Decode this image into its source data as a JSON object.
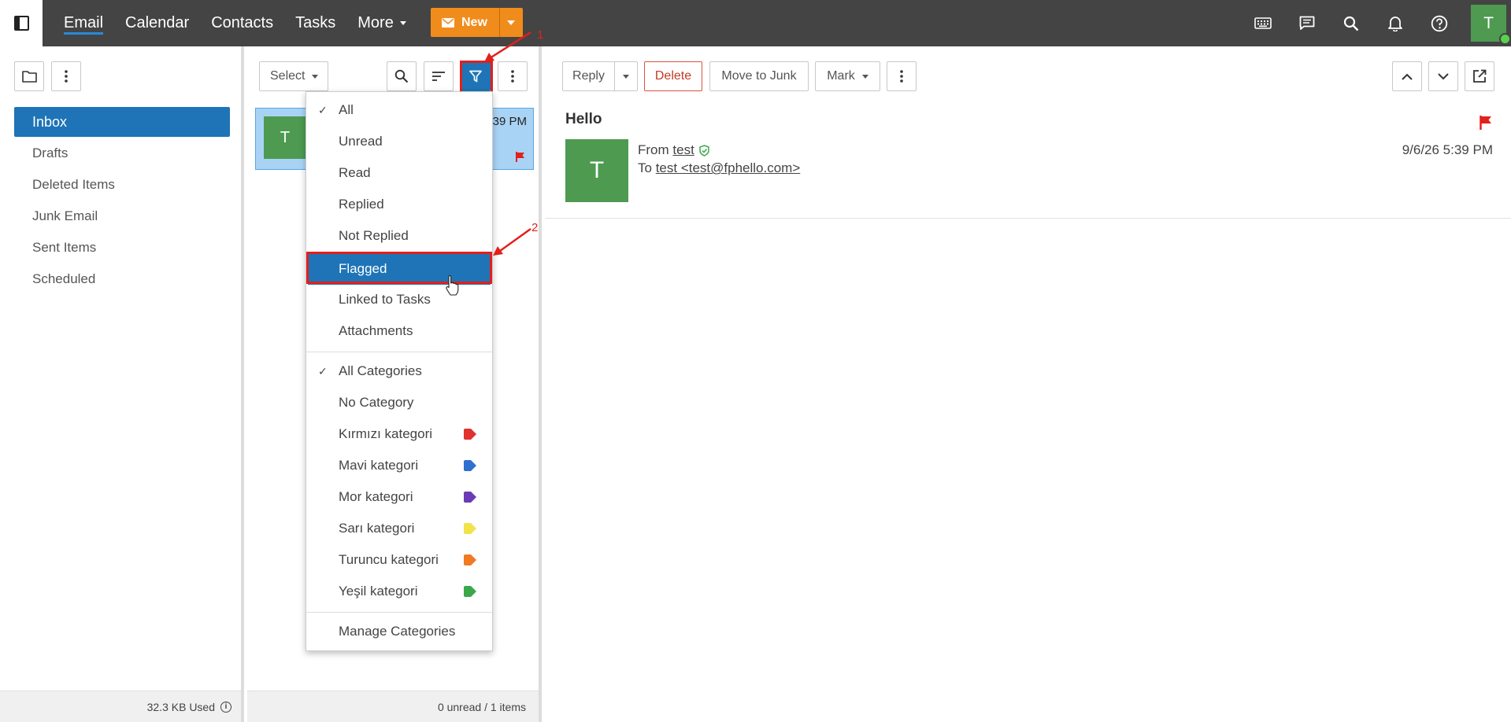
{
  "topbar": {
    "nav": [
      "Email",
      "Calendar",
      "Contacts",
      "Tasks",
      "More"
    ],
    "new_label": "New",
    "avatar_initial": "T",
    "icons": [
      "keyboard-icon",
      "chat-icon",
      "search-icon",
      "bell-icon",
      "help-icon"
    ]
  },
  "folders": {
    "items": [
      "Inbox",
      "Drafts",
      "Deleted Items",
      "Junk Email",
      "Sent Items",
      "Scheduled"
    ],
    "storage_used": "32.3 KB Used"
  },
  "message_list": {
    "select_label": "Select",
    "message": {
      "initial": "T",
      "time": "5:39 PM"
    },
    "footer": "0 unread / 1 items"
  },
  "filter_menu": {
    "status_items": [
      "All",
      "Unread",
      "Read",
      "Replied",
      "Not Replied",
      "Flagged",
      "Linked to Tasks",
      "Attachments"
    ],
    "selected_status": "All",
    "highlighted": "Flagged",
    "category_items": [
      {
        "label": "All Categories",
        "checked": true
      },
      {
        "label": "No Category"
      },
      {
        "label": "Kırmızı kategori",
        "color": "#e0302f"
      },
      {
        "label": "Mavi kategori",
        "color": "#2f6fd0"
      },
      {
        "label": "Mor kategori",
        "color": "#6a3bb5"
      },
      {
        "label": "Sarı kategori",
        "color": "#f2e34a"
      },
      {
        "label": "Turuncu kategori",
        "color": "#f07a22"
      },
      {
        "label": "Yeşil kategori",
        "color": "#3aa84a"
      }
    ],
    "manage_label": "Manage Categories"
  },
  "reading": {
    "toolbar": {
      "reply": "Reply",
      "delete": "Delete",
      "junk": "Move to Junk",
      "mark": "Mark"
    },
    "subject": "Hello",
    "avatar_initial": "T",
    "from_label": "From",
    "from_name": "test",
    "to_label": "To",
    "to_value": "test <test@fphello.com>",
    "date": "9/6/26 5:39 PM"
  },
  "annotations": {
    "one": "1",
    "two": "2"
  },
  "colors": {
    "accent": "#1e74b6",
    "brand_orange": "#f08c1b",
    "avatar_green": "#4e9a51",
    "flag_red": "#e2201c"
  }
}
